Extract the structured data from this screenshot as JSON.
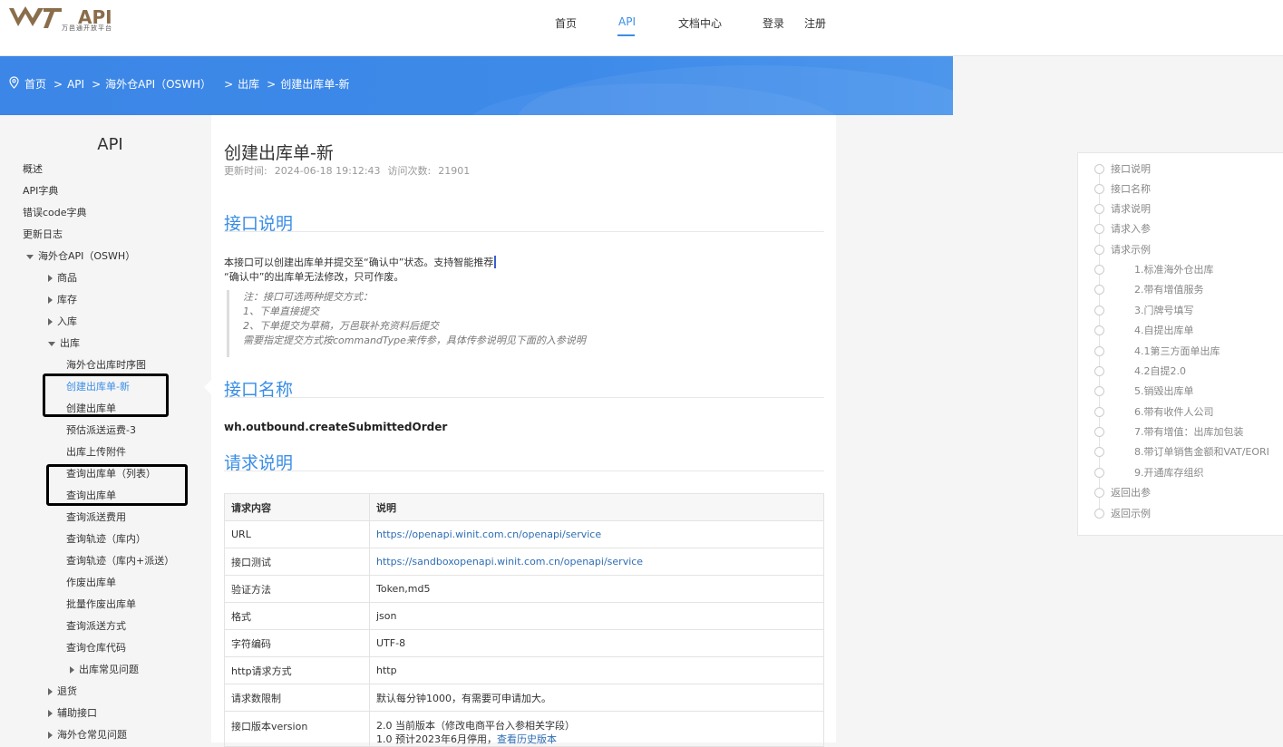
{
  "header": {
    "logo_text": "W7 API",
    "logo_sub": "万邑通开放平台",
    "nav": [
      {
        "label": "首页"
      },
      {
        "label": "API"
      },
      {
        "label": "文档中心"
      },
      {
        "label": "登录"
      },
      {
        "label": "注册"
      }
    ]
  },
  "breadcrumb": [
    "首页",
    "API",
    "海外仓API（OSWH）",
    "出库",
    "创建出库单-新"
  ],
  "breadcrumb_sep": ">",
  "sidebar": {
    "title": "API",
    "items": [
      {
        "label": "概述"
      },
      {
        "label": "API字典"
      },
      {
        "label": "错误code字典"
      },
      {
        "label": "更新日志"
      },
      {
        "label": "海外仓API（OSWH）"
      },
      {
        "label": "商品"
      },
      {
        "label": "库存"
      },
      {
        "label": "入库"
      },
      {
        "label": "出库"
      },
      {
        "label": "海外仓出库时序图"
      },
      {
        "label": "创建出库单-新"
      },
      {
        "label": "创建出库单"
      },
      {
        "label": "预估派送运费-3"
      },
      {
        "label": "出库上传附件"
      },
      {
        "label": "查询出库单（列表）"
      },
      {
        "label": "查询出库单"
      },
      {
        "label": "查询派送费用"
      },
      {
        "label": "查询轨迹（库内）"
      },
      {
        "label": "查询轨迹（库内+派送）"
      },
      {
        "label": "作废出库单"
      },
      {
        "label": "批量作废出库单"
      },
      {
        "label": "查询派送方式"
      },
      {
        "label": "查询仓库代码"
      },
      {
        "label": "出库常见问题"
      },
      {
        "label": "退货"
      },
      {
        "label": "辅助接口"
      },
      {
        "label": "海外仓常见问题"
      }
    ]
  },
  "doc": {
    "title": "创建出库单-新",
    "updated_label": "更新时间:",
    "updated_value": "2024-06-18 19:12:43",
    "visits_label": "访问次数:",
    "visits_value": "21901",
    "sections": {
      "desc": "接口说明",
      "name": "接口名称",
      "request": "请求说明"
    },
    "desc_line1": "本接口可以创建出库单并提交至“确认中”状态。支持智能推荐",
    "desc_line2": "“确认中”的出库单无法修改，只可作废。",
    "note": [
      "注：接口可选两种提交方式：",
      "1、下单直接提交",
      "2、下单提交为草稿，万邑联补充资料后提交",
      "需要指定提交方式按commandType来传参，具体传参说明见下面的入参说明"
    ],
    "method_name": "wh.outbound.createSubmittedOrder",
    "table": {
      "headers": [
        "请求内容",
        "说明"
      ],
      "rows": [
        {
          "k": "URL",
          "v": "https://openapi.winit.com.cn/openapi/service"
        },
        {
          "k": "接口测试",
          "v": "https://sandboxopenapi.winit.com.cn/openapi/service"
        },
        {
          "k": "验证方法",
          "v": "Token,md5"
        },
        {
          "k": "格式",
          "v": "json"
        },
        {
          "k": "字符编码",
          "v": "UTF-8"
        },
        {
          "k": "http请求方式",
          "v": "http"
        },
        {
          "k": "请求数限制",
          "v": "默认每分钟1000，有需要可申请加大。"
        },
        {
          "k": "接口版本version",
          "v": "2.0 当前版本（修改电商平台入参相关字段）",
          "v2": "1.0 预计2023年6月停用，",
          "v2_link": "查看历史版本"
        }
      ]
    }
  },
  "toc": [
    {
      "label": "接口说明"
    },
    {
      "label": "接口名称"
    },
    {
      "label": "请求说明"
    },
    {
      "label": "请求入参"
    },
    {
      "label": "请求示例"
    },
    {
      "label": "1.标准海外仓出库"
    },
    {
      "label": "2.带有增值服务"
    },
    {
      "label": "3.门牌号填写"
    },
    {
      "label": "4.自提出库单"
    },
    {
      "label": "4.1第三方面单出库"
    },
    {
      "label": "4.2自提2.0"
    },
    {
      "label": "5.销毁出库单"
    },
    {
      "label": "6.带有收件人公司"
    },
    {
      "label": "7.带有增值：出库加包装"
    },
    {
      "label": "8.带订单销售金额和VAT/EORI"
    },
    {
      "label": "9.开通库存组织"
    },
    {
      "label": "返回出参"
    },
    {
      "label": "返回示例"
    }
  ],
  "colors": {
    "accent": "#3a8ee6",
    "banner": "#3d8ae9"
  }
}
